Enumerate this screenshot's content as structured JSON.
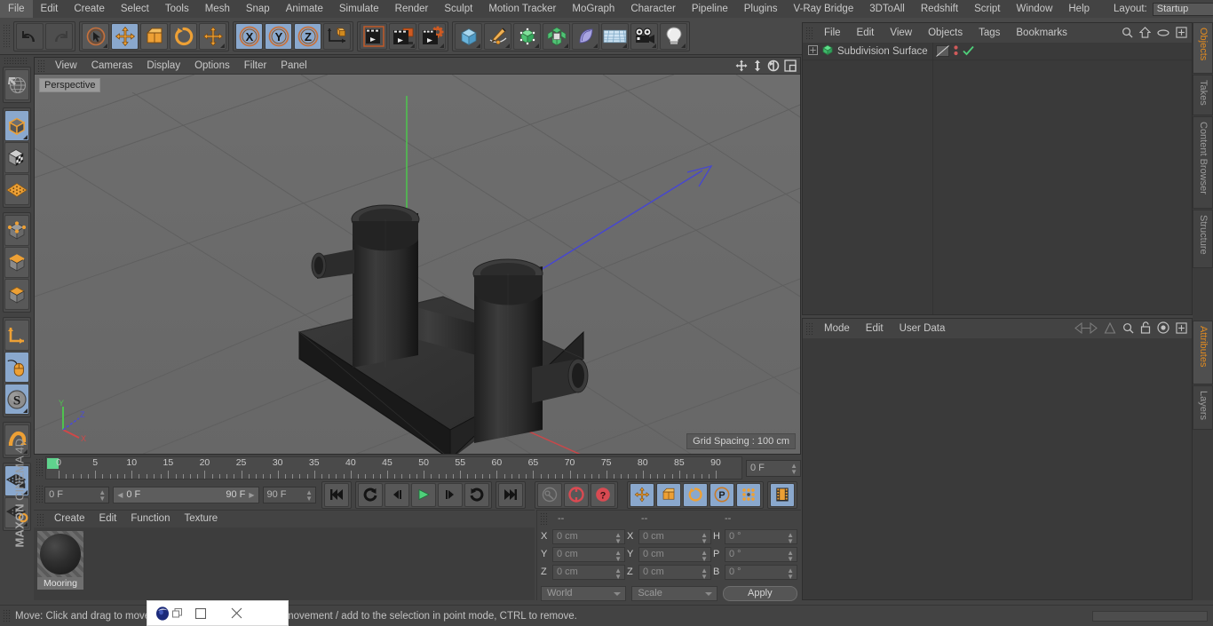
{
  "menubar": {
    "items": [
      "File",
      "Edit",
      "Create",
      "Select",
      "Tools",
      "Mesh",
      "Snap",
      "Animate",
      "Simulate",
      "Render",
      "Sculpt",
      "Motion Tracker",
      "MoGraph",
      "Character",
      "Pipeline",
      "Plugins",
      "V-Ray Bridge",
      "3DToAll",
      "Redshift",
      "Script",
      "Window",
      "Help"
    ],
    "layout_label": "Layout:",
    "layout_value": "Startup",
    "search_icon": "magnifier-icon"
  },
  "toolbar": {
    "groups": [
      {
        "name": "history",
        "buttons": [
          {
            "name": "undo",
            "icon": "undo-arrow-icon",
            "state": "normal"
          },
          {
            "name": "redo",
            "icon": "redo-arrow-icon",
            "state": "disabled"
          }
        ]
      },
      {
        "name": "transform",
        "buttons": [
          {
            "name": "live-selection",
            "icon": "cursor-circle-icon",
            "state": "normal"
          },
          {
            "name": "move",
            "icon": "move-arrows-icon",
            "state": "active"
          },
          {
            "name": "scale",
            "icon": "scale-box-icon",
            "state": "normal"
          },
          {
            "name": "rotate",
            "icon": "rotate-circle-icon",
            "state": "normal"
          },
          {
            "name": "move-dup",
            "icon": "move-arrows-icon",
            "state": "normal"
          }
        ]
      },
      {
        "name": "axis-lock",
        "buttons": [
          {
            "name": "x-axis",
            "icon": "x-axis-icon",
            "state": "active"
          },
          {
            "name": "y-axis",
            "icon": "y-axis-icon",
            "state": "active"
          },
          {
            "name": "z-axis",
            "icon": "z-axis-icon",
            "state": "active"
          },
          {
            "name": "world-object-coord",
            "icon": "world-axis-icon",
            "state": "normal"
          }
        ]
      },
      {
        "name": "render",
        "buttons": [
          {
            "name": "render-view",
            "icon": "clapper-icon",
            "state": "normal"
          },
          {
            "name": "render-to-picture-viewer",
            "icon": "clapper-window-icon",
            "state": "normal"
          },
          {
            "name": "render-settings",
            "icon": "clapper-gear-icon",
            "state": "normal"
          }
        ]
      },
      {
        "name": "creation",
        "buttons": [
          {
            "name": "add-cube-object",
            "icon": "blue-cube-icon",
            "state": "normal"
          },
          {
            "name": "add-spline",
            "icon": "pen-spline-icon",
            "state": "normal"
          },
          {
            "name": "add-nurbs",
            "icon": "green-cube-points-icon",
            "state": "normal"
          },
          {
            "name": "add-modeling-object",
            "icon": "green-cluster-icon",
            "state": "normal"
          },
          {
            "name": "add-deformer",
            "icon": "bend-deformer-icon",
            "state": "normal"
          },
          {
            "name": "add-environment",
            "icon": "floor-grid-icon",
            "state": "normal"
          },
          {
            "name": "add-camera",
            "icon": "camera-icon",
            "state": "normal"
          },
          {
            "name": "add-light",
            "icon": "light-bulb-icon",
            "state": "normal"
          }
        ]
      }
    ]
  },
  "left_toolbar": {
    "buttons": [
      {
        "name": "undo-view",
        "icon": "globe-wire-icon",
        "state": "normal"
      },
      {
        "name": "model-mode",
        "icon": "orange-outline-cube-icon",
        "state": "active"
      },
      {
        "name": "texture-mode",
        "icon": "checker-cube-icon",
        "state": "normal"
      },
      {
        "name": "workplane-mode",
        "icon": "orange-grid-plane-icon",
        "state": "normal"
      },
      {
        "name": "points-mode",
        "icon": "cube-points-icon",
        "state": "normal"
      },
      {
        "name": "edges-mode",
        "icon": "cube-edges-icon",
        "state": "normal"
      },
      {
        "name": "polygons-mode",
        "icon": "cube-polygon-icon",
        "state": "normal"
      },
      {
        "name": "object-axis-mode",
        "icon": "orange-axis-icon",
        "state": "normal"
      },
      {
        "name": "enable-snapping",
        "icon": "mouse-icon",
        "state": "active"
      },
      {
        "name": "soft-selection",
        "icon": "s-sphere-icon",
        "state": "active"
      },
      {
        "name": "magnet-tool",
        "icon": "magnet-icon",
        "state": "normal"
      },
      {
        "name": "lock-workplane",
        "icon": "grid-lock-icon",
        "state": "active"
      },
      {
        "name": "align-workplane",
        "icon": "grid-rotate-icon",
        "state": "normal"
      }
    ],
    "brand_line1": "MAXON",
    "brand_line2": "CINEMA 4D"
  },
  "viewport": {
    "menu": [
      "View",
      "Cameras",
      "Display",
      "Options",
      "Filter",
      "Panel"
    ],
    "corner_icons": [
      "pan-icon",
      "dolly-icon",
      "rotate-view-icon",
      "maximize-view-icon"
    ],
    "perspective_label": "Perspective",
    "grid_spacing": "Grid Spacing : 100 cm",
    "axis_labels": {
      "x": "X",
      "y": "Y",
      "z": "Z"
    }
  },
  "timeline": {
    "ticks": [
      0,
      5,
      10,
      15,
      20,
      25,
      30,
      35,
      40,
      45,
      50,
      55,
      60,
      65,
      70,
      75,
      80,
      85,
      90
    ],
    "current_frame_field": "0 F",
    "current_frame_right": "0 F",
    "range_start": "0 F",
    "range_end": "90 F",
    "end_frame_field": "90 F",
    "transport": [
      {
        "name": "go-to-start",
        "icon": "skip-start-icon"
      },
      {
        "name": "play-backwards-loop",
        "icon": "loop-back-icon"
      },
      {
        "name": "step-back",
        "icon": "step-back-icon"
      },
      {
        "name": "play-forward",
        "icon": "play-icon"
      },
      {
        "name": "step-forward",
        "icon": "step-forward-icon"
      },
      {
        "name": "play-loop",
        "icon": "loop-forward-icon"
      },
      {
        "name": "go-to-end",
        "icon": "skip-end-icon"
      }
    ],
    "keyframe_tools": [
      {
        "name": "record-active-objects",
        "icon": "key-icon"
      },
      {
        "name": "autokeying",
        "icon": "red-circle-arrow-icon"
      },
      {
        "name": "keyframe-selection",
        "icon": "red-question-icon"
      }
    ],
    "param_toggles": [
      {
        "name": "position-key",
        "icon": "move-arrows-icon",
        "state": "active"
      },
      {
        "name": "scale-key",
        "icon": "scale-box-icon",
        "state": "active"
      },
      {
        "name": "rotation-key",
        "icon": "rotate-circle-icon",
        "state": "active"
      },
      {
        "name": "param-key",
        "icon": "p-circle-icon",
        "state": "active"
      },
      {
        "name": "point-level-animation",
        "icon": "dots-grid-icon",
        "state": "active"
      },
      {
        "name": "animation-layers",
        "icon": "film-strip-icon",
        "state": "active"
      }
    ]
  },
  "material_manager": {
    "menu": [
      "Create",
      "Edit",
      "Function",
      "Texture"
    ],
    "materials": [
      {
        "name": "Mooring",
        "label": "Mooring"
      }
    ]
  },
  "coordinate_manager": {
    "headers": [
      "--",
      "--",
      "--"
    ],
    "rows": [
      {
        "pos_label": "X",
        "pos_value": "0 cm",
        "size_label": "X",
        "size_value": "0 cm",
        "rot_label": "H",
        "rot_value": "0 °"
      },
      {
        "pos_label": "Y",
        "pos_value": "0 cm",
        "size_label": "Y",
        "size_value": "0 cm",
        "rot_label": "P",
        "rot_value": "0 °"
      },
      {
        "pos_label": "Z",
        "pos_value": "0 cm",
        "size_label": "Z",
        "size_value": "0 cm",
        "rot_label": "B",
        "rot_value": "0 °"
      }
    ],
    "coord_system": "World",
    "size_mode": "Scale",
    "apply_label": "Apply"
  },
  "object_manager": {
    "menu": [
      "File",
      "Edit",
      "View",
      "Objects",
      "Tags",
      "Bookmarks"
    ],
    "header_icons": [
      "search-icon",
      "home-icon",
      "eye-icon",
      "plus-box-icon"
    ],
    "objects": [
      {
        "name": "Subdivision Surface",
        "expander": "plus-box-icon",
        "icon": "subdivision-surface-icon",
        "tags": [
          "material-tag",
          "visibility-dots",
          "green-check-icon"
        ]
      }
    ]
  },
  "attribute_manager": {
    "menu": [
      "Mode",
      "Edit",
      "User Data"
    ],
    "header_icons": [
      "interpolation-icon",
      "triangle-icon",
      "search-icon",
      "lock-icon",
      "target-icon",
      "plus-box-icon"
    ]
  },
  "right_tabs": {
    "upper": [
      {
        "label": "Objects",
        "selected": true
      },
      {
        "label": "Takes",
        "selected": false
      },
      {
        "label": "Content Browser",
        "selected": false
      },
      {
        "label": "Structure",
        "selected": false
      }
    ],
    "lower": [
      {
        "label": "Attributes",
        "selected": true
      },
      {
        "label": "Layers",
        "selected": false
      }
    ]
  },
  "statusbar": {
    "text": "Move: Click and drag to move elements. SHIFT to quantize movement / add to the selection in point mode, CTRL to remove."
  },
  "mini_window": {
    "app_icon": "cinema4d-icon",
    "restore_icon": "restore-window-icon",
    "maximize_icon": "maximize-window-icon",
    "close_icon": "close-window-icon"
  },
  "colors": {
    "accent_orange": "#e08a20",
    "active_blue": "#8aa8cd",
    "panel_bg": "#434343",
    "viewport_bg": "#6b6b6b",
    "axis_x": "#d04040",
    "axis_y": "#55c455",
    "axis_z": "#4040d0"
  }
}
